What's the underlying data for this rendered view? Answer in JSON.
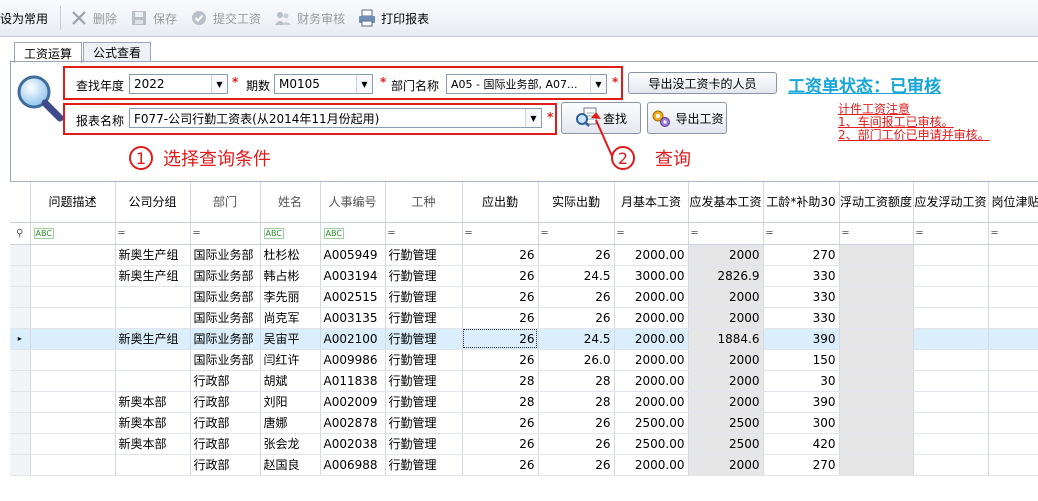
{
  "toolbar": {
    "items": [
      {
        "label": "设为常用",
        "icon": "star-icon",
        "enabled": true
      },
      {
        "label": "删除",
        "icon": "delete-icon",
        "enabled": false
      },
      {
        "label": "保存",
        "icon": "save-icon",
        "enabled": false
      },
      {
        "label": "提交工资",
        "icon": "submit-icon",
        "enabled": false
      },
      {
        "label": "财务审核",
        "icon": "audit-icon",
        "enabled": false
      },
      {
        "label": "打印报表",
        "icon": "print-icon",
        "enabled": true
      }
    ]
  },
  "tabs": [
    "工资运算",
    "公式查看"
  ],
  "query": {
    "year_label": "查找年度",
    "year_value": "2022",
    "period_label": "期数",
    "period_value": "M0105",
    "dept_label": "部门名称",
    "dept_value": "A05 - 国际业务部, A07...",
    "report_label": "报表名称",
    "report_value": "F077-公司行勤工资表(从2014年11月份起用)",
    "required_mark": "*"
  },
  "buttons": {
    "export_missing": "导出没工资卡的人员",
    "search": "查找",
    "export_salary": "导出工资"
  },
  "status_text": "工资单状态：已审核",
  "notes": [
    "计件工资注意",
    "1、车间报工已审核。",
    "2、部门工价已申请并审核。"
  ],
  "annotations": {
    "step1_num": "1",
    "step1_text": "选择查询条件",
    "step2_num": "2",
    "step2_text": "查询"
  },
  "grid": {
    "columns": [
      "问题描述",
      "公司分组",
      "部门",
      "姓名",
      "人事编号",
      "工种",
      "应出勤",
      "实际出勤",
      "月基本工资",
      "应发基本工资",
      "工龄*补助30",
      "浮动工资额度",
      "应发浮动工资",
      "岗位津贴度"
    ],
    "filter_abc": "ABC",
    "filter_eq": "═",
    "rows": [
      [
        "",
        "新奥生产组",
        "国际业务部",
        "杜杉松",
        "A005949",
        "行勤管理",
        "26",
        "26",
        "2000.00",
        "2000",
        "270"
      ],
      [
        "",
        "新奥生产组",
        "国际业务部",
        "韩占彬",
        "A003194",
        "行勤管理",
        "26",
        "24.5",
        "3000.00",
        "2826.9",
        "330"
      ],
      [
        "",
        "",
        "国际业务部",
        "李先丽",
        "A002515",
        "行勤管理",
        "26",
        "26",
        "2000.00",
        "2000",
        "330"
      ],
      [
        "",
        "",
        "国际业务部",
        "尚克军",
        "A003135",
        "行勤管理",
        "26",
        "26",
        "2000.00",
        "2000",
        "330"
      ],
      [
        "",
        "新奥生产组",
        "国际业务部",
        "吴宙平",
        "A002100",
        "行勤管理",
        "26",
        "24.5",
        "2000.00",
        "1884.6",
        "390"
      ],
      [
        "",
        "",
        "国际业务部",
        "闫红许",
        "A009986",
        "行勤管理",
        "26",
        "26.0",
        "2000.00",
        "2000",
        "150"
      ],
      [
        "",
        "",
        "行政部",
        "胡斌",
        "A011838",
        "行勤管理",
        "28",
        "28",
        "2000.00",
        "2000",
        "30"
      ],
      [
        "",
        "新奥本部",
        "行政部",
        "刘阳",
        "A002009",
        "行勤管理",
        "28",
        "28",
        "2000.00",
        "2000",
        "390"
      ],
      [
        "",
        "新奥本部",
        "行政部",
        "唐娜",
        "A002878",
        "行勤管理",
        "26",
        "26",
        "2500.00",
        "2500",
        "300"
      ],
      [
        "",
        "新奥本部",
        "行政部",
        "张会龙",
        "A002038",
        "行勤管理",
        "26",
        "26",
        "2500.00",
        "2500",
        "420"
      ],
      [
        "",
        "",
        "行政部",
        "赵国良",
        "A006988",
        "行勤管理",
        "26",
        "26",
        "2000.00",
        "2000",
        "270"
      ]
    ],
    "selected_row": 4
  }
}
